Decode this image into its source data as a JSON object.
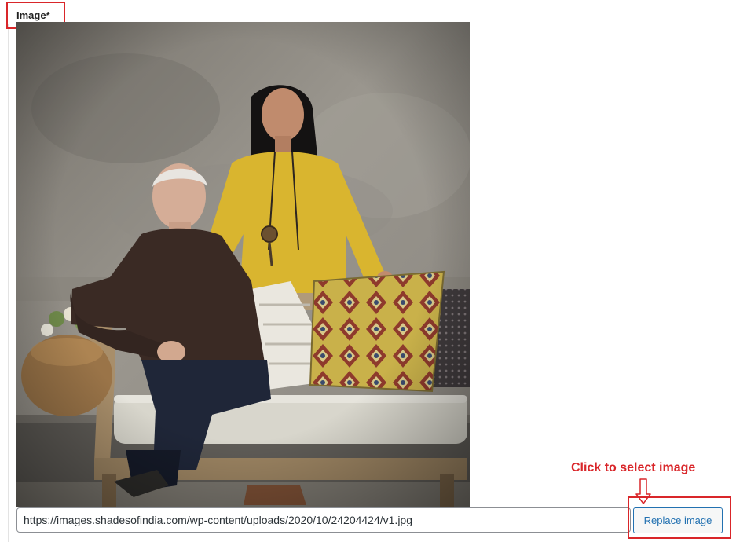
{
  "field": {
    "label": "Image*"
  },
  "image": {
    "alt": "Photo of a man seated on a daybed and a woman in yellow standing behind"
  },
  "annotation": {
    "text": "Click to select image"
  },
  "url_field": {
    "value": "https://images.shadesofindia.com/wp-content/uploads/2020/10/24204424/v1.jpg"
  },
  "actions": {
    "replace_label": "Replace image"
  },
  "colors": {
    "highlight": "#d9262a",
    "button_accent": "#2271b1"
  }
}
